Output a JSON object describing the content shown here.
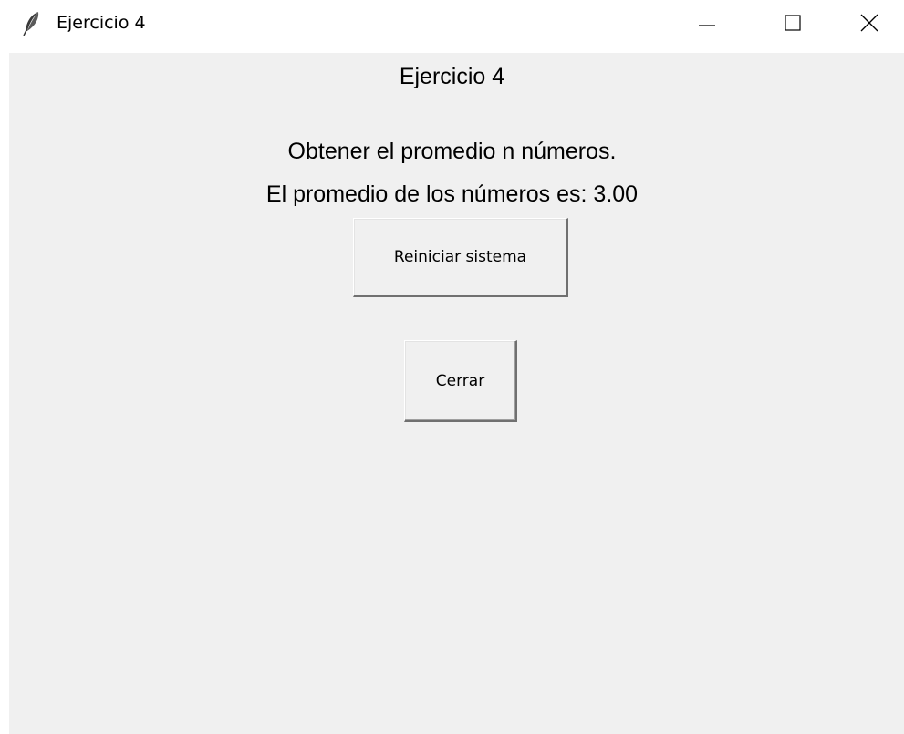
{
  "window": {
    "title": "Ejercicio 4",
    "controls": {
      "minimize_icon": "minimize-icon",
      "maximize_icon": "maximize-icon",
      "close_icon": "close-icon"
    }
  },
  "content": {
    "title": "Ejercicio 4",
    "subtitle": "Obtener el promedio n números.",
    "result": "El promedio de los números es: 3.00"
  },
  "buttons": {
    "reset_label": "Reiniciar sistema",
    "close_label": "Cerrar"
  },
  "colors": {
    "client_background": "#f0f0f0",
    "titlebar_background": "#ffffff",
    "text": "#000000"
  }
}
